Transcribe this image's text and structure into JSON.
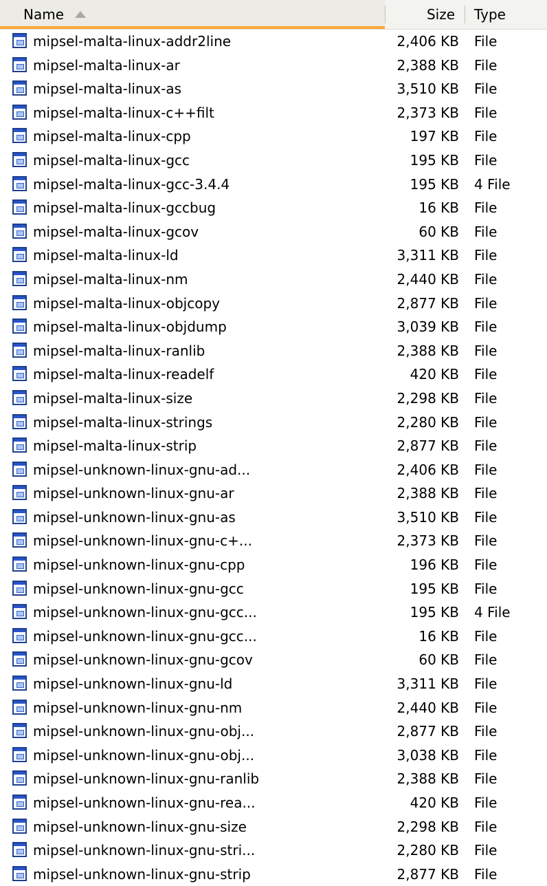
{
  "columns": {
    "name": "Name",
    "size": "Size",
    "type": "Type"
  },
  "sort": {
    "column": "Name",
    "direction": "ascending",
    "icon": "sort-up-arrow-icon"
  },
  "file_icon": "executable-file-icon",
  "colors": {
    "sorted_column_underline": "#f9a93a",
    "header_background": "#f3f3ef"
  },
  "files": [
    {
      "name": "mipsel-malta-linux-addr2line",
      "size": "2,406 KB",
      "type": "File"
    },
    {
      "name": "mipsel-malta-linux-ar",
      "size": "2,388 KB",
      "type": "File"
    },
    {
      "name": "mipsel-malta-linux-as",
      "size": "3,510 KB",
      "type": "File"
    },
    {
      "name": "mipsel-malta-linux-c++filt",
      "size": "2,373 KB",
      "type": "File"
    },
    {
      "name": "mipsel-malta-linux-cpp",
      "size": "197 KB",
      "type": "File"
    },
    {
      "name": "mipsel-malta-linux-gcc",
      "size": "195 KB",
      "type": "File"
    },
    {
      "name": "mipsel-malta-linux-gcc-3.4.4",
      "size": "195 KB",
      "type": "4 File"
    },
    {
      "name": "mipsel-malta-linux-gccbug",
      "size": "16 KB",
      "type": "File"
    },
    {
      "name": "mipsel-malta-linux-gcov",
      "size": "60 KB",
      "type": "File"
    },
    {
      "name": "mipsel-malta-linux-ld",
      "size": "3,311 KB",
      "type": "File"
    },
    {
      "name": "mipsel-malta-linux-nm",
      "size": "2,440 KB",
      "type": "File"
    },
    {
      "name": "mipsel-malta-linux-objcopy",
      "size": "2,877 KB",
      "type": "File"
    },
    {
      "name": "mipsel-malta-linux-objdump",
      "size": "3,039 KB",
      "type": "File"
    },
    {
      "name": "mipsel-malta-linux-ranlib",
      "size": "2,388 KB",
      "type": "File"
    },
    {
      "name": "mipsel-malta-linux-readelf",
      "size": "420 KB",
      "type": "File"
    },
    {
      "name": "mipsel-malta-linux-size",
      "size": "2,298 KB",
      "type": "File"
    },
    {
      "name": "mipsel-malta-linux-strings",
      "size": "2,280 KB",
      "type": "File"
    },
    {
      "name": "mipsel-malta-linux-strip",
      "size": "2,877 KB",
      "type": "File"
    },
    {
      "name": "mipsel-unknown-linux-gnu-ad...",
      "size": "2,406 KB",
      "type": "File"
    },
    {
      "name": "mipsel-unknown-linux-gnu-ar",
      "size": "2,388 KB",
      "type": "File"
    },
    {
      "name": "mipsel-unknown-linux-gnu-as",
      "size": "3,510 KB",
      "type": "File"
    },
    {
      "name": "mipsel-unknown-linux-gnu-c+...",
      "size": "2,373 KB",
      "type": "File"
    },
    {
      "name": "mipsel-unknown-linux-gnu-cpp",
      "size": "196 KB",
      "type": "File"
    },
    {
      "name": "mipsel-unknown-linux-gnu-gcc",
      "size": "195 KB",
      "type": "File"
    },
    {
      "name": "mipsel-unknown-linux-gnu-gcc...",
      "size": "195 KB",
      "type": "4 File"
    },
    {
      "name": "mipsel-unknown-linux-gnu-gcc...",
      "size": "16 KB",
      "type": "File"
    },
    {
      "name": "mipsel-unknown-linux-gnu-gcov",
      "size": "60 KB",
      "type": "File"
    },
    {
      "name": "mipsel-unknown-linux-gnu-ld",
      "size": "3,311 KB",
      "type": "File"
    },
    {
      "name": "mipsel-unknown-linux-gnu-nm",
      "size": "2,440 KB",
      "type": "File"
    },
    {
      "name": "mipsel-unknown-linux-gnu-obj...",
      "size": "2,877 KB",
      "type": "File"
    },
    {
      "name": "mipsel-unknown-linux-gnu-obj...",
      "size": "3,038 KB",
      "type": "File"
    },
    {
      "name": "mipsel-unknown-linux-gnu-ranlib",
      "size": "2,388 KB",
      "type": "File"
    },
    {
      "name": "mipsel-unknown-linux-gnu-rea...",
      "size": "420 KB",
      "type": "File"
    },
    {
      "name": "mipsel-unknown-linux-gnu-size",
      "size": "2,298 KB",
      "type": "File"
    },
    {
      "name": "mipsel-unknown-linux-gnu-stri...",
      "size": "2,280 KB",
      "type": "File"
    },
    {
      "name": "mipsel-unknown-linux-gnu-strip",
      "size": "2,877 KB",
      "type": "File"
    }
  ]
}
